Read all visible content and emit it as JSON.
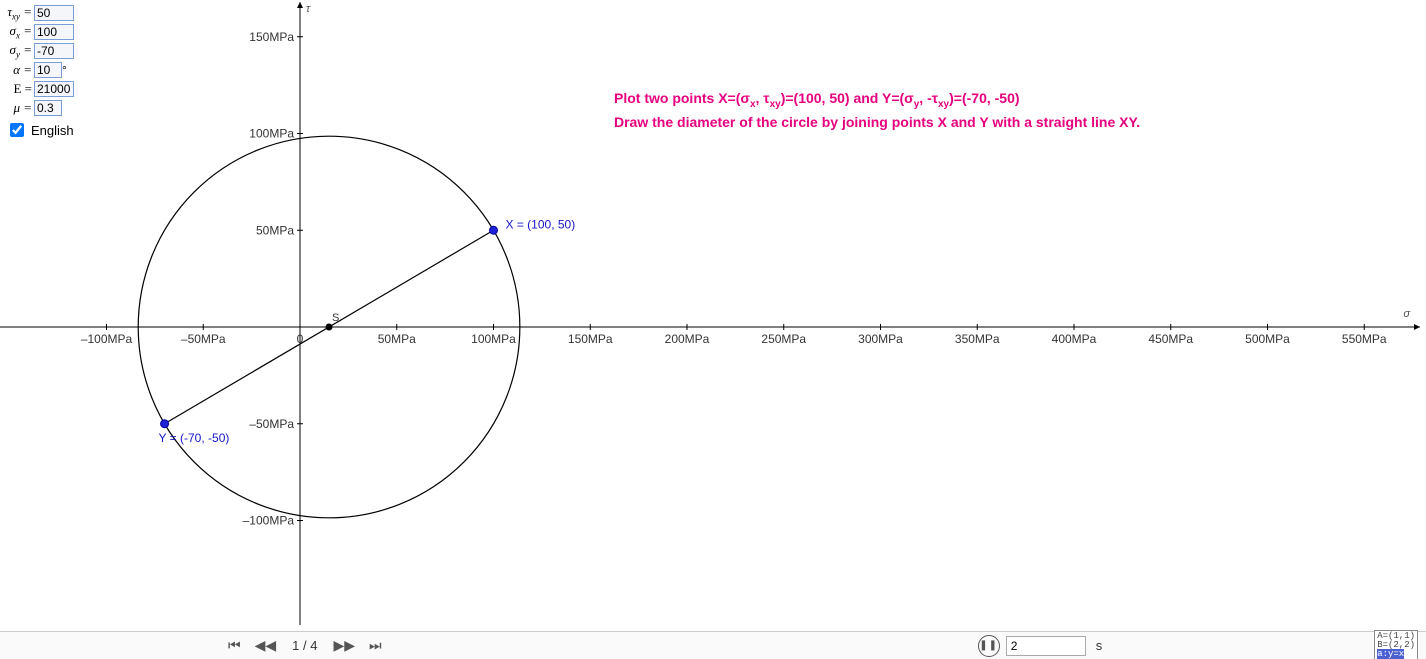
{
  "inputs": {
    "tauxy": {
      "label": "τ",
      "sub": "xy",
      "eq": " = ",
      "value": "50"
    },
    "sigmax": {
      "label": "σ",
      "sub": "x",
      "eq": " = ",
      "value": "100"
    },
    "sigmay": {
      "label": "σ",
      "sub": "y",
      "eq": " = ",
      "value": "-70"
    },
    "alpha": {
      "label": "α",
      "sub": "",
      "eq": " = ",
      "value": "10",
      "suffix": "°"
    },
    "E": {
      "label": "E",
      "sub": "",
      "eq": " = ",
      "value": "21000"
    },
    "mu": {
      "label": "μ",
      "sub": "",
      "eq": " = ",
      "value": "0.3"
    }
  },
  "checkbox": {
    "label": "English",
    "checked": true
  },
  "description": {
    "line1_pre": "Plot two points X=(σ",
    "line1_sub1": "x",
    "line1_mid1": ", τ",
    "line1_sub2": "xy",
    "line1_mid2": ")=(100, 50)   and Y=(σ",
    "line1_sub3": "y",
    "line1_mid3": ", -τ",
    "line1_sub4": "xy",
    "line1_post": ")=(-70, -50)",
    "line2": "Draw the diameter of the circle by joining points X and Y with a straight line XY."
  },
  "toolbar": {
    "step": "1 / 4",
    "speed_value": "2",
    "speed_unit": "s"
  },
  "chart_data": {
    "type": "scatter",
    "title": "",
    "xlabel": "σ",
    "ylabel": "τ",
    "x_unit": "MPa",
    "y_unit": "MPa",
    "xlim": [
      -130,
      580
    ],
    "ylim": [
      -170,
      170
    ],
    "x_ticks": [
      -100,
      -50,
      0,
      50,
      100,
      150,
      200,
      250,
      300,
      350,
      400,
      450,
      500,
      550
    ],
    "y_ticks": [
      -100,
      -50,
      50,
      100,
      150
    ],
    "points": [
      {
        "name": "X",
        "x": 100,
        "y": 50,
        "label": "X = (100, 50)"
      },
      {
        "name": "Y",
        "x": -70,
        "y": -50,
        "label": "Y = (-70, -50)"
      },
      {
        "name": "S",
        "x": 15,
        "y": 0,
        "label": "S"
      }
    ],
    "circle": {
      "cx": 15,
      "cy": 0,
      "r": 98.615
    },
    "diameter": {
      "x1": -70,
      "y1": -50,
      "x2": 100,
      "y2": 50
    }
  }
}
